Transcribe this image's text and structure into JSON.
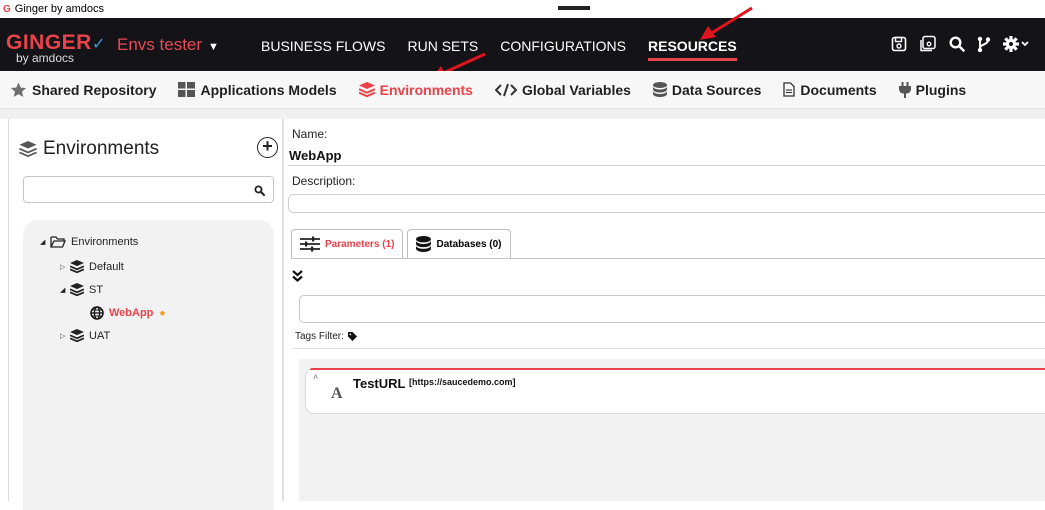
{
  "window": {
    "title": "Ginger by amdocs",
    "logo_glyph": "G"
  },
  "topnav": {
    "brand_name": "GINGER",
    "brand_sub": "by amdocs",
    "solution_name": "Envs tester",
    "links": [
      {
        "label": "BUSINESS FLOWS",
        "active": false
      },
      {
        "label": "RUN SETS",
        "active": false
      },
      {
        "label": "CONFIGURATIONS",
        "active": false
      },
      {
        "label": "RESOURCES",
        "active": true
      }
    ],
    "icons": [
      "save-icon",
      "save-all-icon",
      "search-icon",
      "source-control-icon",
      "settings-icon"
    ]
  },
  "resources_toolbar": {
    "items": [
      {
        "label": "Shared Repository",
        "icon": "star-icon",
        "active": false
      },
      {
        "label": "Applications Models",
        "icon": "grid-icon",
        "active": false
      },
      {
        "label": "Environments",
        "icon": "layers-icon",
        "active": true
      },
      {
        "label": "Global  Variables",
        "icon": "code-icon",
        "active": false
      },
      {
        "label": "Data Sources",
        "icon": "database-icon",
        "active": false
      },
      {
        "label": "Documents",
        "icon": "document-icon",
        "active": false
      },
      {
        "label": "Plugins",
        "icon": "plug-icon",
        "active": false
      }
    ]
  },
  "environments_panel": {
    "title": "Environments",
    "search_placeholder": "",
    "tree": {
      "root": "Environments",
      "items": [
        {
          "label": "Default",
          "level": 1,
          "expanded": false
        },
        {
          "label": "ST",
          "level": 1,
          "expanded": true
        },
        {
          "label": "WebApp",
          "level": 2,
          "selected": true,
          "modified": true
        },
        {
          "label": "UAT",
          "level": 1,
          "expanded": false
        }
      ]
    }
  },
  "details": {
    "name_label": "Name:",
    "name_value": "WebApp",
    "description_label": "Description:",
    "description_value": "",
    "tabs": [
      {
        "label": "Parameters (1)",
        "active": true
      },
      {
        "label": "Databases (0)",
        "active": false
      }
    ],
    "tags_filter_label": "Tags Filter:",
    "parameters": [
      {
        "name": "TestURL",
        "value": "[https://saucedemo.com]",
        "type": "A"
      }
    ]
  },
  "colors": {
    "accent": "#e8434b",
    "nav_bg": "#141318",
    "modified_dot": "#f39c12",
    "annotation_arrow": "#e0141e"
  }
}
